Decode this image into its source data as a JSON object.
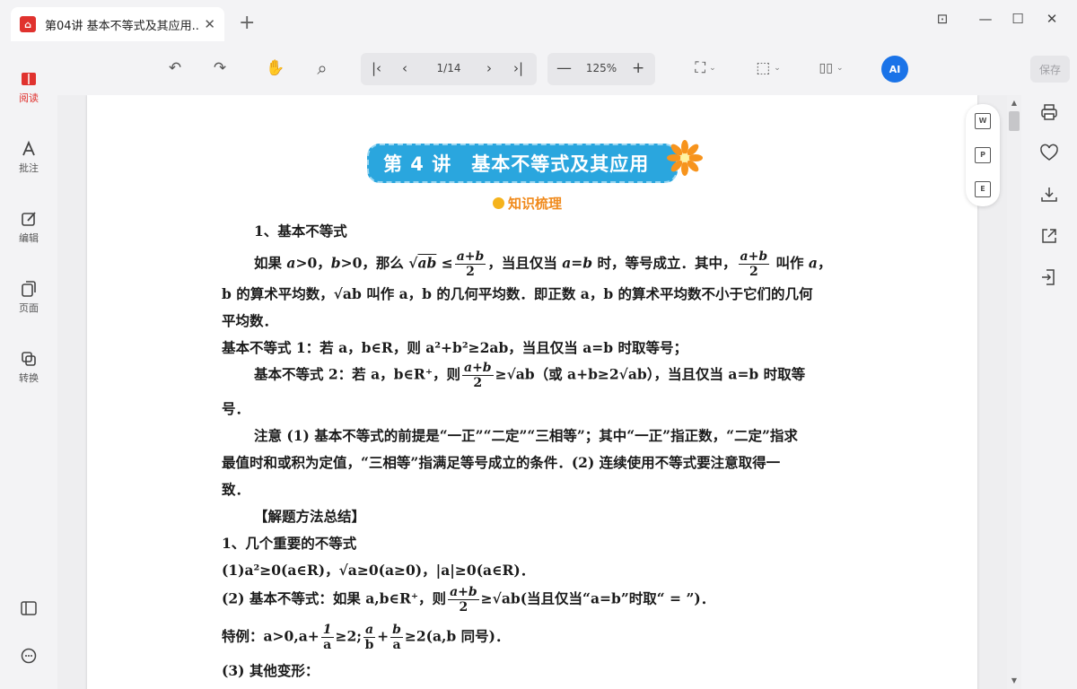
{
  "tab": {
    "icon": "pdf-icon",
    "title": "第04讲 基本不等式及其应用....",
    "close": "✕",
    "new": "+"
  },
  "window": {
    "feedback": "⊡",
    "minimize": "—",
    "maximize": "☐",
    "close": "✕"
  },
  "toolbar": {
    "undo": "↶",
    "redo": "↷",
    "hand": "✋",
    "search": "⌕",
    "first": "|‹",
    "prev": "‹",
    "page": "1/14",
    "next": "›",
    "last": "›|",
    "zoom_out": "—",
    "zoom": "125%",
    "zoom_in": "+",
    "fit": "⛶",
    "fullscreen": "⬚",
    "layout": "▯▯",
    "ai": "AI",
    "save": "保存"
  },
  "sidebar": {
    "items": [
      {
        "label": "阅读",
        "icon": "book-icon",
        "active": true
      },
      {
        "label": "批注",
        "icon": "annotate-icon"
      },
      {
        "label": "编辑",
        "icon": "edit-icon"
      },
      {
        "label": "页面",
        "icon": "pages-icon"
      },
      {
        "label": "转换",
        "icon": "convert-icon"
      }
    ]
  },
  "floatbar": {
    "word": "W",
    "ppt": "P",
    "excel": "E"
  },
  "right_tools": [
    "print-icon",
    "favorite-icon",
    "download-icon",
    "share-icon",
    "export-icon"
  ],
  "doc": {
    "banner": "第 4 讲　基本不等式及其应用",
    "subtitle": "知识梳理",
    "h1": "1、基本不等式",
    "p1a_pre": "如果 ",
    "p1a_m1": "a",
    "p1a_t1": ">0，",
    "p1a_m2": "b",
    "p1a_t2": ">0，那么 √",
    "p1a_m3": "ab",
    "p1a_t3": " ≤",
    "frac_ab_num": "a+b",
    "frac_ab_den": "2",
    "p1a_t4": "，当且仅当 ",
    "p1a_m4": "a",
    "p1a_t5": "=",
    "p1a_m5": "b",
    "p1a_t6": " 时，等号成立．其中，",
    "p1a_t7": " 叫作 ",
    "p1a_m6": "a",
    "p1a_t8": "，",
    "p1b": "b 的算术平均数，√ab 叫作 a，b 的几何平均数．即正数 a，b 的算术平均数不小于它们的几何",
    "p1c": "平均数．",
    "p2": "基本不等式 1：若 a，b∈R，则 a²+b²≥2ab，当且仅当 a=b 时取等号；",
    "p3a_pre": "基本不等式 2：若 a，b∈R⁺，则",
    "p3a_post": "≥√ab（或 a+b≥2√ab），当且仅当 a=b 时取等",
    "p3b": "号．",
    "p4a": "注意 (1) 基本不等式的前提是“一正”“二定”“三相等”；其中“一正”指正数，“二定”指求",
    "p4b": "最值时和或积为定值，“三相等”指满足等号成立的条件．(2) 连续使用不等式要注意取得一",
    "p4c": "致．",
    "h2": "【解题方法总结】",
    "h3": "1、几个重要的不等式",
    "p5": "(1)a²≥0(a∈R)，√a≥0(a≥0)，|a|≥0(a∈R)．",
    "p6_pre": "(2) 基本不等式：如果 a,b∈R⁺，则",
    "p6_post": "≥√ab(当且仅当“a=b”时取“ = ”)．",
    "p7_pre": "特例：a>0,a+",
    "frac_1a_num": "1",
    "frac_1a_den": "a",
    "p7_mid": "≥2;",
    "frac_ab2_num": "a",
    "frac_ab2_den": "b",
    "p7_plus": "+",
    "frac_ba_num": "b",
    "frac_ba_den": "a",
    "p7_post": "≥2(a,b 同号)．",
    "p8": "(3) 其他变形："
  }
}
